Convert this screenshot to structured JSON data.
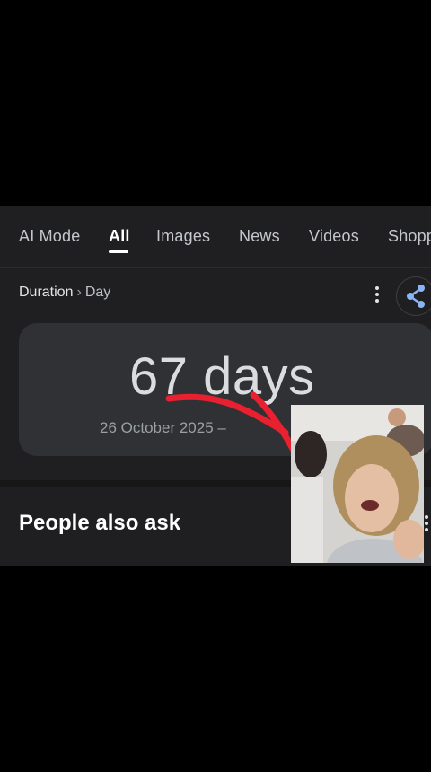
{
  "tabs": [
    {
      "label": "AI Mode",
      "active": false
    },
    {
      "label": "All",
      "active": true
    },
    {
      "label": "Images",
      "active": false
    },
    {
      "label": "News",
      "active": false
    },
    {
      "label": "Videos",
      "active": false
    },
    {
      "label": "Shopp",
      "active": false
    }
  ],
  "breadcrumb": {
    "first": "Duration",
    "separator": "›",
    "second": "Day"
  },
  "result": {
    "value": "67 days",
    "range": "26 October 2025 –"
  },
  "people_also_ask": {
    "title": "People also ask"
  },
  "icons": {
    "more": "more-vert-icon",
    "share": "share-icon"
  },
  "colors": {
    "page_background": "#000000",
    "panel_background": "#1f1f21",
    "card_background": "#303134",
    "annotation_arrow": "#e8202f",
    "share_accent": "#8ab4f8"
  }
}
